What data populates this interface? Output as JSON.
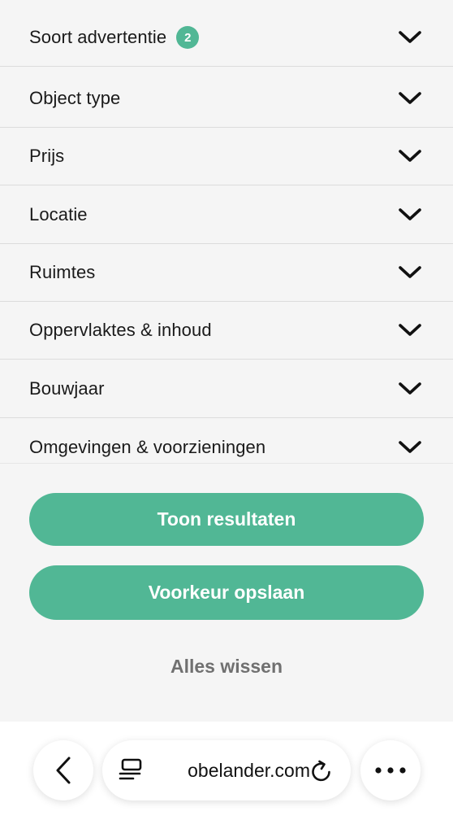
{
  "filters": [
    {
      "label": "Soort advertentie",
      "badge": "2",
      "icon": "chevron-down-icon"
    },
    {
      "label": "Object type",
      "icon": "chevron-down-icon"
    },
    {
      "label": "Prijs",
      "icon": "chevron-down-icon"
    },
    {
      "label": "Locatie",
      "icon": "chevron-down-icon"
    },
    {
      "label": "Ruimtes",
      "icon": "chevron-down-icon"
    },
    {
      "label": "Oppervlaktes & inhoud",
      "icon": "chevron-down-icon"
    },
    {
      "label": "Bouwjaar",
      "icon": "chevron-down-icon"
    },
    {
      "label": "Omgevingen & voorzieningen",
      "icon": "chevron-down-icon"
    }
  ],
  "actions": {
    "show_results": "Toon resultaten",
    "save_preference": "Voorkeur opslaan",
    "clear_all": "Alles wissen"
  },
  "browser": {
    "url": "obelander.com",
    "icons": [
      "back-arrow-icon",
      "tab-overview-icon",
      "reload-icon",
      "more-dots-icon"
    ]
  },
  "colors": {
    "accent": "#51b795",
    "background": "#f5f5f5",
    "divider": "#dcdcdc",
    "clear_text": "#707070"
  }
}
